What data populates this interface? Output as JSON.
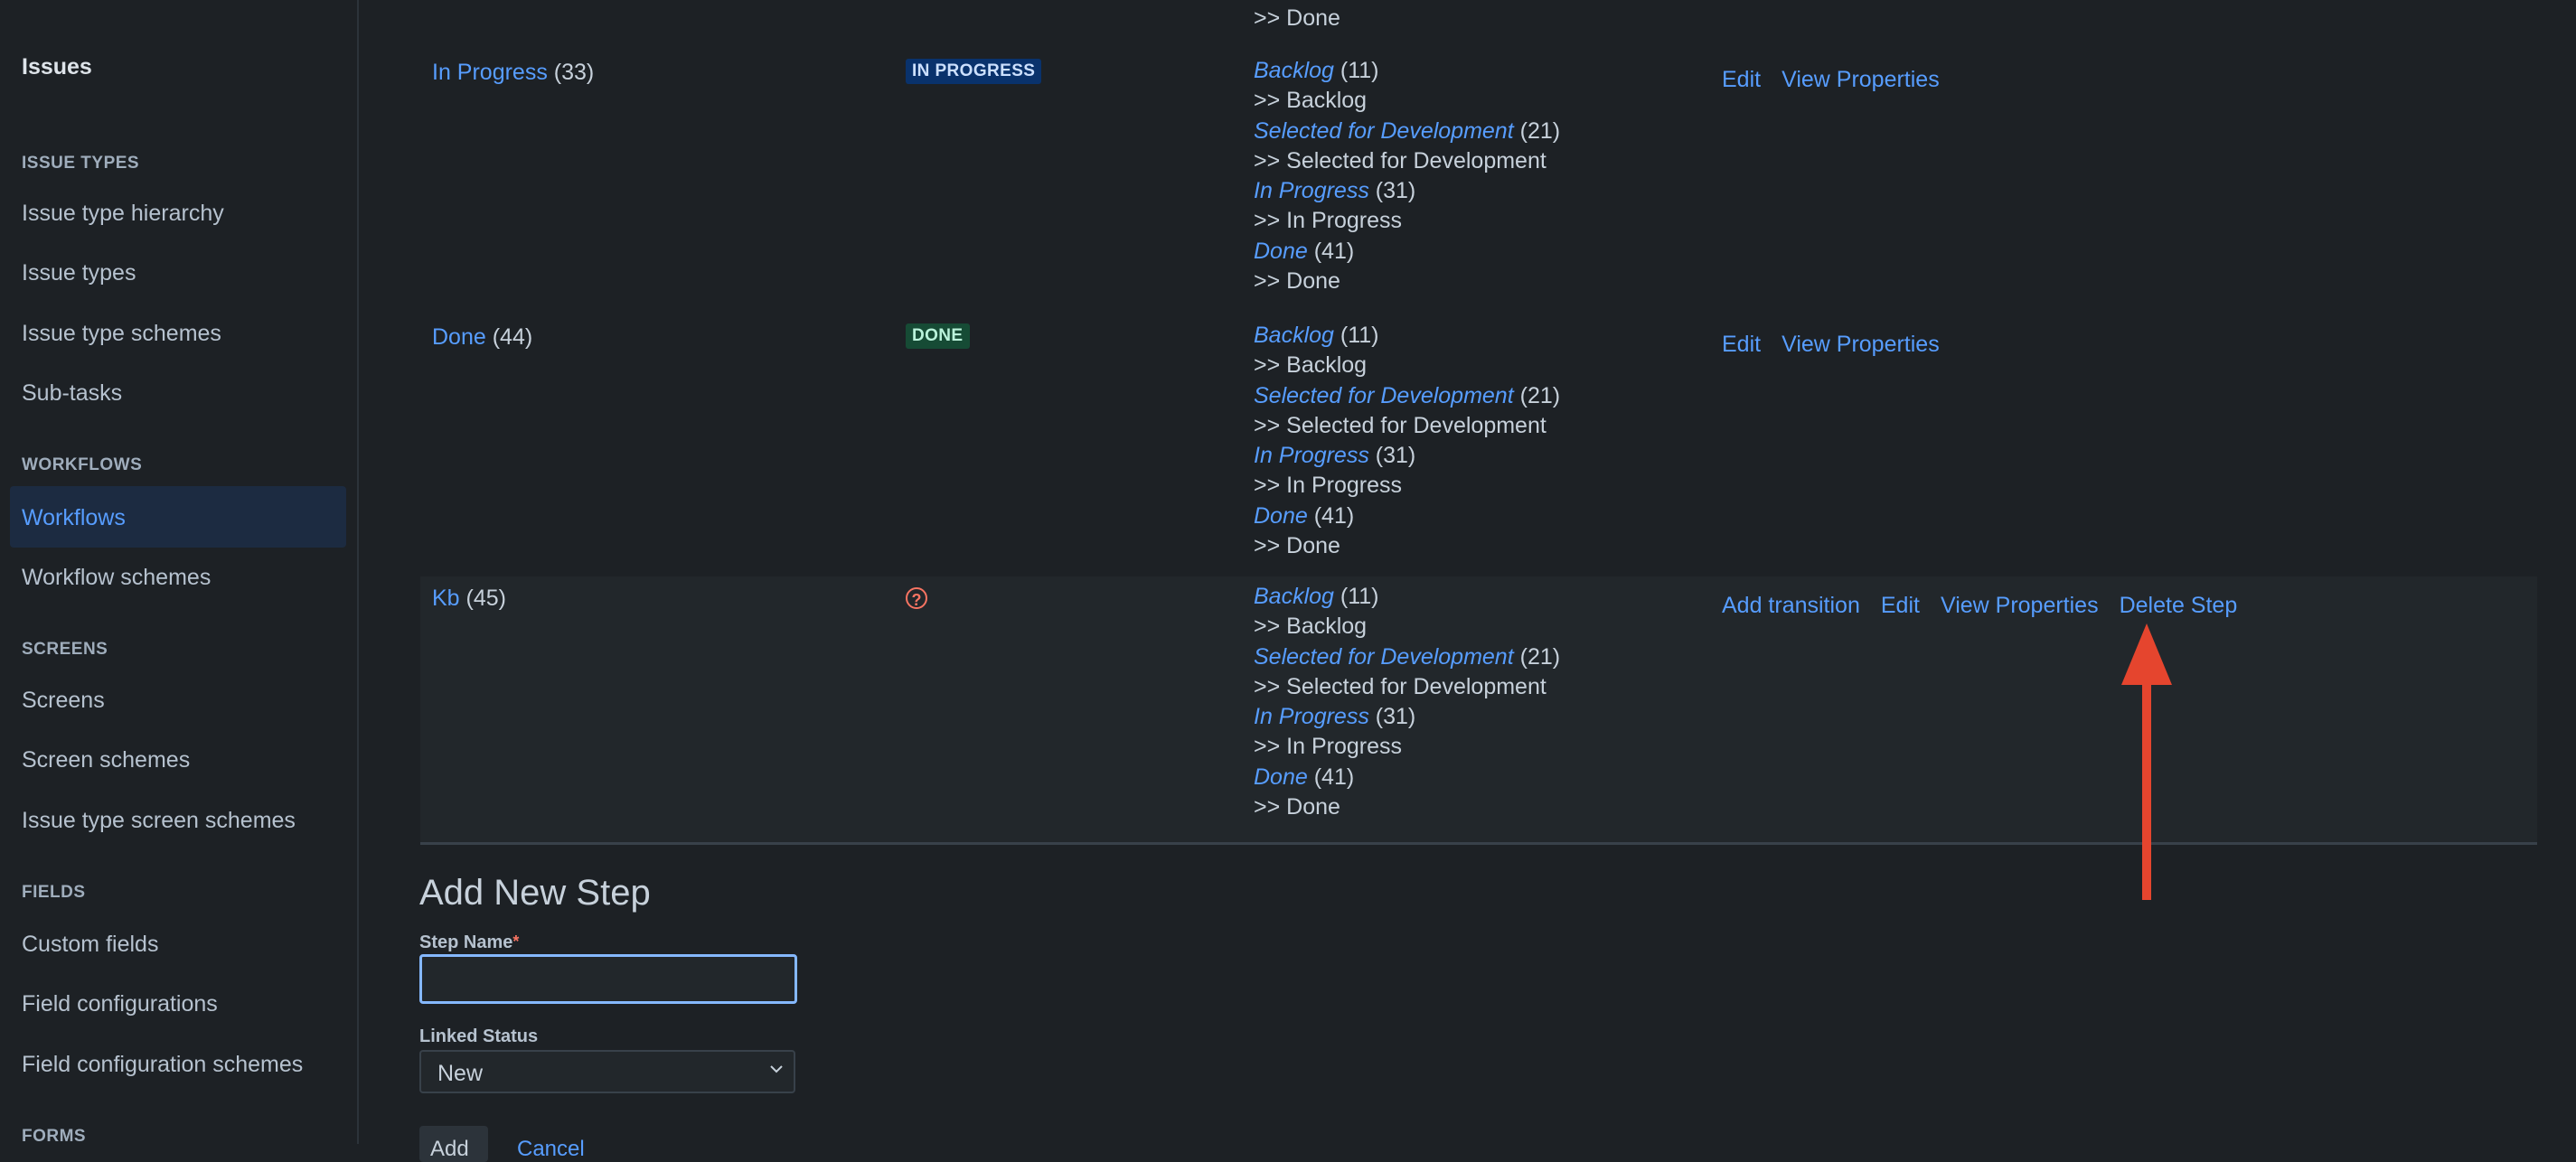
{
  "sidebar": {
    "title": "Issues",
    "sections": [
      {
        "heading": "ISSUE TYPES",
        "items": [
          "Issue type hierarchy",
          "Issue types",
          "Issue type schemes",
          "Sub-tasks"
        ]
      },
      {
        "heading": "WORKFLOWS",
        "items": [
          "Workflows",
          "Workflow schemes"
        ]
      },
      {
        "heading": "SCREENS",
        "items": [
          "Screens",
          "Screen schemes",
          "Issue type screen schemes"
        ]
      },
      {
        "heading": "FIELDS",
        "items": [
          "Custom fields",
          "Field configurations",
          "Field configuration schemes"
        ]
      },
      {
        "heading": "FORMS",
        "items": []
      }
    ],
    "active_item": "Workflows"
  },
  "top_partial": {
    "line": ">> Done"
  },
  "rows": [
    {
      "step_name": "In Progress",
      "step_count": "(33)",
      "status": "IN PROGRESS",
      "transitions": [
        {
          "name": "Backlog",
          "count": "(11)",
          "target": ">> Backlog"
        },
        {
          "name": "Selected for Development",
          "count": "(21)",
          "target": ">> Selected for Development"
        },
        {
          "name": "In Progress",
          "count": "(31)",
          "target": ">> In Progress"
        },
        {
          "name": "Done",
          "count": "(41)",
          "target": ">> Done"
        }
      ],
      "operations": [
        "Edit",
        "View Properties"
      ]
    },
    {
      "step_name": "Done",
      "step_count": "(44)",
      "status": "DONE",
      "transitions": [
        {
          "name": "Backlog",
          "count": "(11)",
          "target": ">> Backlog"
        },
        {
          "name": "Selected for Development",
          "count": "(21)",
          "target": ">> Selected for Development"
        },
        {
          "name": "In Progress",
          "count": "(31)",
          "target": ">> In Progress"
        },
        {
          "name": "Done",
          "count": "(41)",
          "target": ">> Done"
        }
      ],
      "operations": [
        "Edit",
        "View Properties"
      ]
    },
    {
      "step_name": "Kb",
      "step_count": "(45)",
      "status_icon": "question-circle-icon",
      "transitions": [
        {
          "name": "Backlog",
          "count": "(11)",
          "target": ">> Backlog"
        },
        {
          "name": "Selected for Development",
          "count": "(21)",
          "target": ">> Selected for Development"
        },
        {
          "name": "In Progress",
          "count": "(31)",
          "target": ">> In Progress"
        },
        {
          "name": "Done",
          "count": "(41)",
          "target": ">> Done"
        }
      ],
      "operations": [
        "Add transition",
        "Edit",
        "View Properties",
        "Delete Step"
      ]
    }
  ],
  "form": {
    "title": "Add New Step",
    "step_name_label": "Step Name",
    "required_marker": "*",
    "step_name_value": "",
    "linked_status_label": "Linked Status",
    "linked_status_value": "New",
    "add_label": "Add",
    "cancel_label": "Cancel"
  },
  "colors": {
    "accent": "#579dff",
    "annotation": "#e5452e"
  }
}
